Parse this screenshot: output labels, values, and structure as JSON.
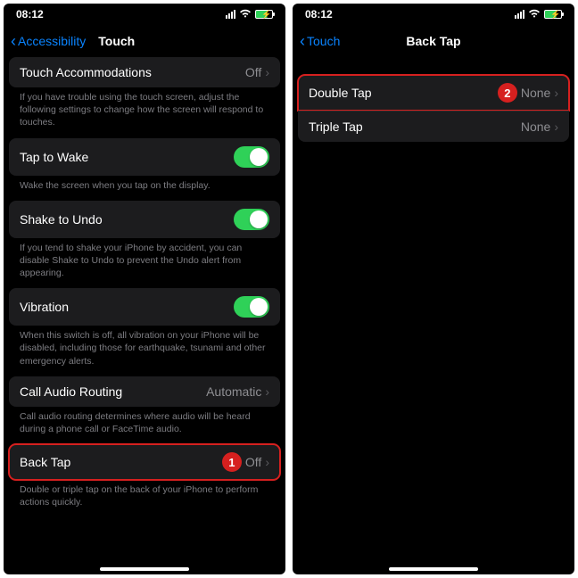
{
  "status": {
    "time": "08:12"
  },
  "left": {
    "back": "Accessibility",
    "title": "Touch",
    "accom": {
      "label": "Touch Accommodations",
      "value": "Off"
    },
    "accom_f": "If you have trouble using the touch screen, adjust the following settings to change how the screen will respond to touches.",
    "tapwake": {
      "label": "Tap to Wake"
    },
    "tapwake_f": "Wake the screen when you tap on the display.",
    "shake": {
      "label": "Shake to Undo"
    },
    "shake_f": "If you tend to shake your iPhone by accident, you can disable Shake to Undo to prevent the Undo alert from appearing.",
    "vib": {
      "label": "Vibration"
    },
    "vib_f": "When this switch is off, all vibration on your iPhone will be disabled, including those for earthquake, tsunami and other emergency alerts.",
    "audio": {
      "label": "Call Audio Routing",
      "value": "Automatic"
    },
    "audio_f": "Call audio routing determines where audio will be heard during a phone call or FaceTime audio.",
    "backtap": {
      "label": "Back Tap",
      "value": "Off"
    },
    "backtap_f": "Double or triple tap on the back of your iPhone to perform actions quickly.",
    "badge": "1"
  },
  "right": {
    "back": "Touch",
    "title": "Back Tap",
    "double": {
      "label": "Double Tap",
      "value": "None"
    },
    "triple": {
      "label": "Triple Tap",
      "value": "None"
    },
    "badge": "2"
  }
}
